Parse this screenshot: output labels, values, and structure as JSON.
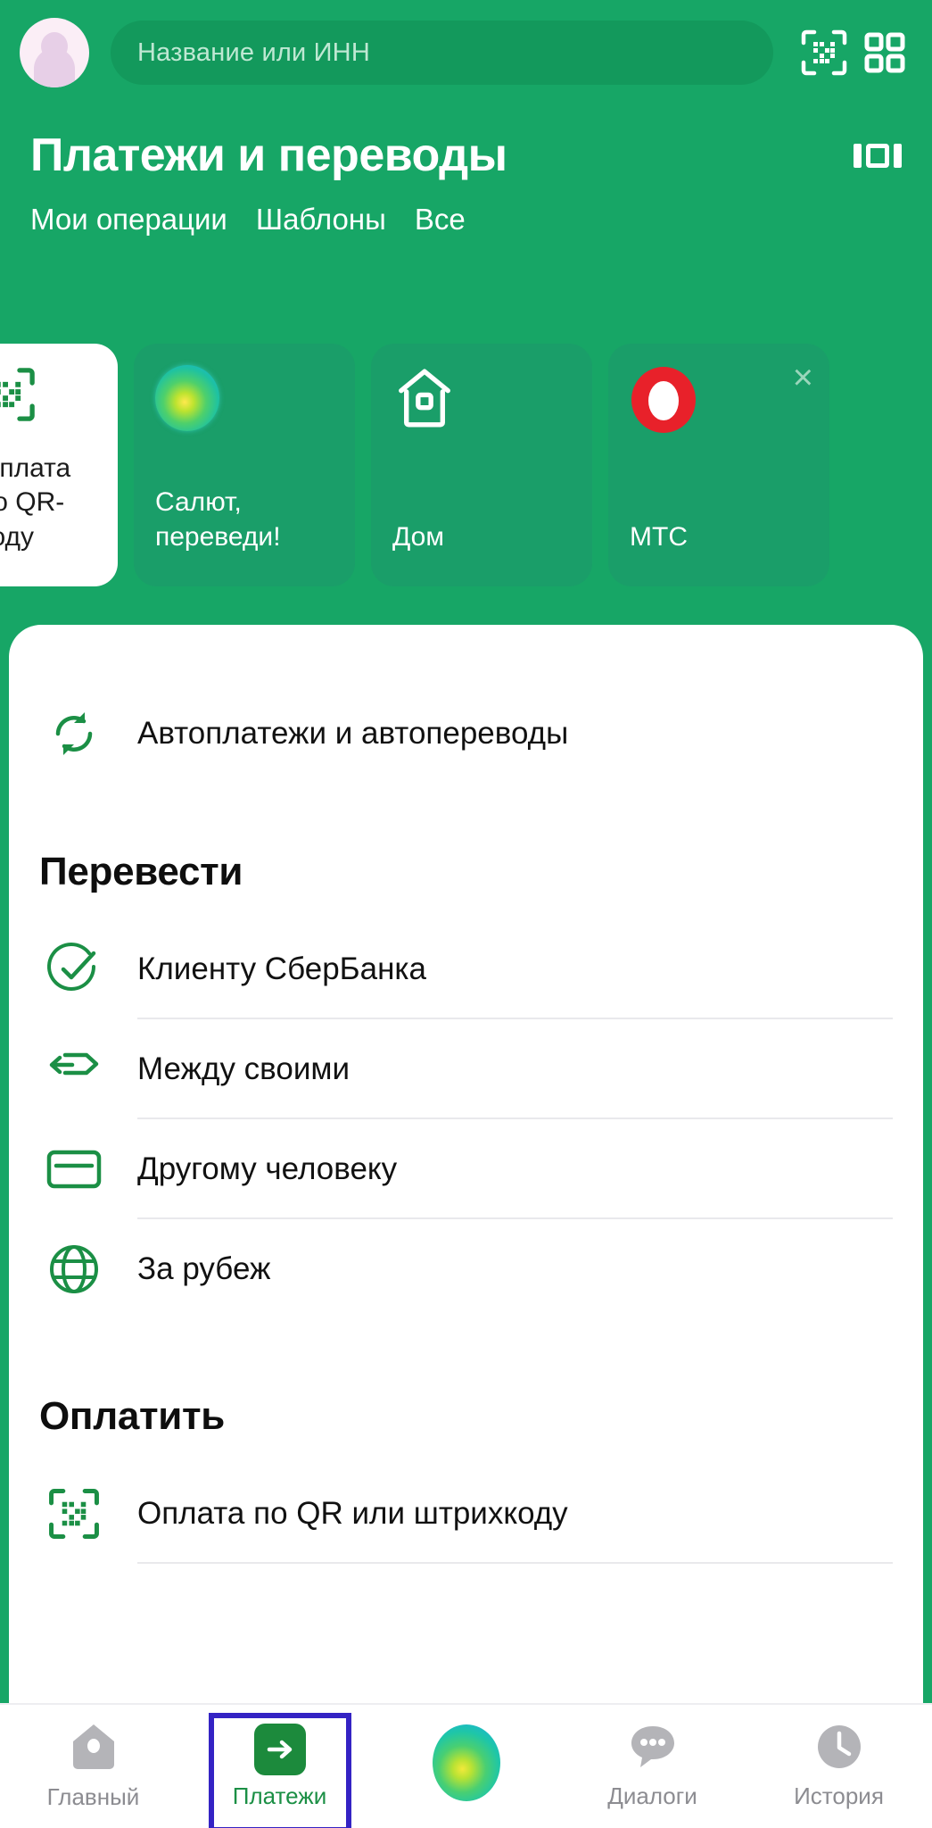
{
  "app": {
    "accent_green": "#17a666",
    "card_green": "#1a9e69",
    "icon_green": "#1b8f45",
    "highlight_blue": "#3423c4"
  },
  "header": {
    "avatar_name": "user-avatar",
    "search": {
      "placeholder": "Название или ИНН",
      "value": ""
    },
    "scan_icon_label": "qr-scan-icon",
    "grid_icon_label": "grid-apps-icon",
    "title": "Платежи и переводы",
    "carousel_indicator_label": "carousel-view-icon"
  },
  "tabs": [
    {
      "label": "Мои операции"
    },
    {
      "label": "Шаблоны"
    },
    {
      "label": "Все"
    }
  ],
  "story_cards": [
    {
      "label": "Оплата по QR-коду",
      "icon": "qr-scan-icon",
      "theme": "white",
      "closable": false
    },
    {
      "label": "Салют, переведи!",
      "icon": "salute-orb-icon",
      "theme": "green",
      "closable": false
    },
    {
      "label": "Дом",
      "icon": "home-outline-icon",
      "theme": "green",
      "closable": false
    },
    {
      "label": "МТС",
      "icon": "mts-egg-icon",
      "theme": "green",
      "closable": true,
      "close_label": "×"
    }
  ],
  "sheet": {
    "autopay_row": {
      "label": "Автоплатежи и автопереводы",
      "icon": "sync-arrows-icon"
    },
    "transfer_section": {
      "title": "Перевести",
      "rows": [
        {
          "label": "Клиенту СберБанка",
          "icon": "check-circle-icon"
        },
        {
          "label": "Между своими",
          "icon": "exchange-arrows-icon"
        },
        {
          "label": "Другому человеку",
          "icon": "credit-card-icon"
        },
        {
          "label": "За рубеж",
          "icon": "globe-icon"
        }
      ]
    },
    "pay_section": {
      "title": "Оплатить",
      "rows": [
        {
          "label": "Оплата по QR или штрихкоду",
          "icon": "qr-scan-icon"
        }
      ]
    }
  },
  "bottom_nav": [
    {
      "label": "Главный",
      "icon": "home-filled-icon",
      "active": false
    },
    {
      "label": "Платежи",
      "icon": "payments-arrow-icon",
      "active": true,
      "highlighted": true
    },
    {
      "label": "",
      "icon": "salute-orb-icon",
      "active": false
    },
    {
      "label": "Диалоги",
      "icon": "chat-bubble-icon",
      "active": false
    },
    {
      "label": "История",
      "icon": "clock-icon",
      "active": false
    }
  ]
}
